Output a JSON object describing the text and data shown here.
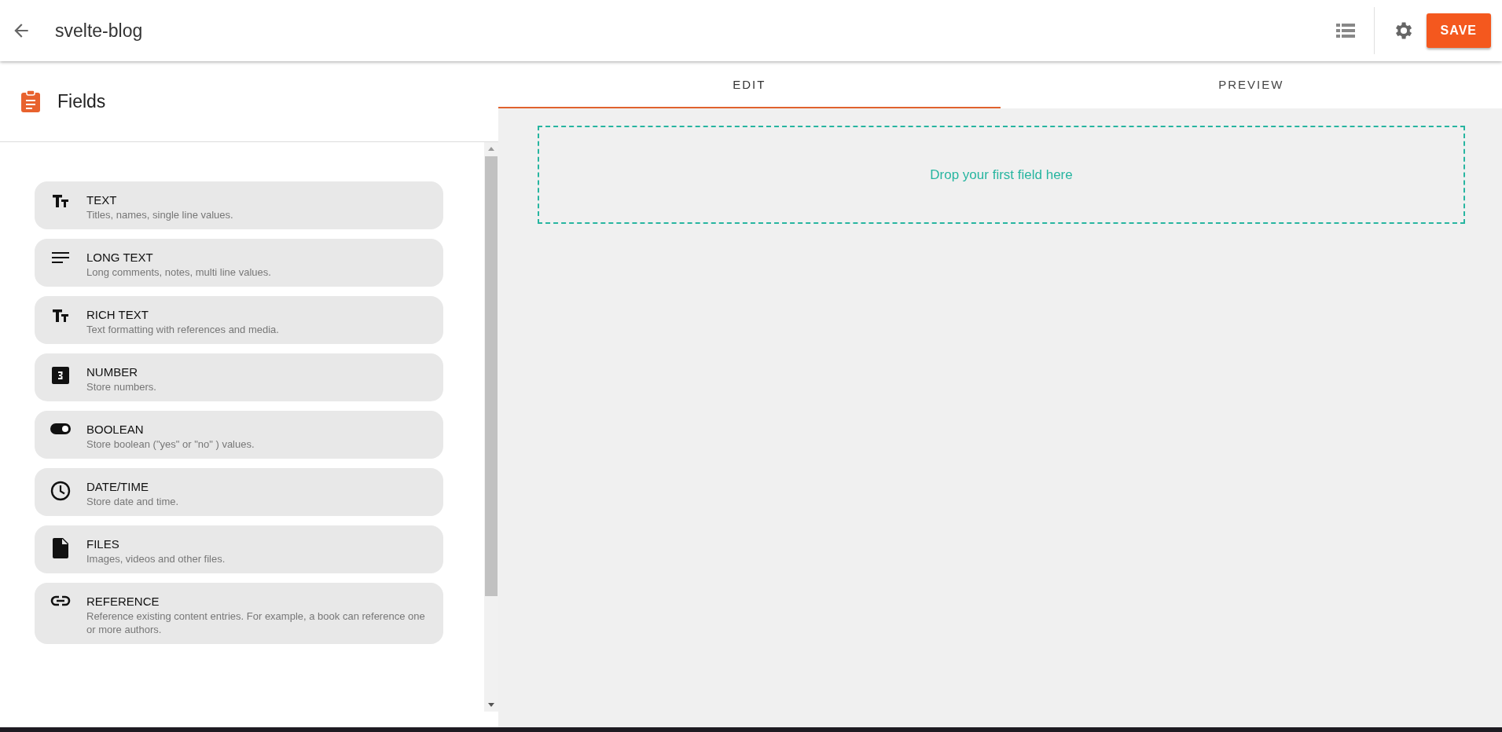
{
  "app_bar": {
    "title": "svelte-blog",
    "save_label": "SAVE"
  },
  "sidebar": {
    "title": "Fields",
    "items": [
      {
        "kind": "text",
        "label": "TEXT",
        "description": "Titles, names, single line values."
      },
      {
        "kind": "longtext",
        "label": "LONG TEXT",
        "description": "Long comments, notes, multi line values."
      },
      {
        "kind": "richtext",
        "label": "RICH TEXT",
        "description": "Text formatting with references and media."
      },
      {
        "kind": "number",
        "label": "NUMBER",
        "description": "Store numbers."
      },
      {
        "kind": "boolean",
        "label": "BOOLEAN",
        "description": "Store boolean (\"yes\" or \"no\" ) values."
      },
      {
        "kind": "datetime",
        "label": "DATE/TIME",
        "description": "Store date and time."
      },
      {
        "kind": "files",
        "label": "FILES",
        "description": "Images, videos and other files."
      },
      {
        "kind": "reference",
        "label": "REFERENCE",
        "description": "Reference existing content entries. For example, a book can reference one or more authors."
      }
    ]
  },
  "tabs": [
    {
      "label": "EDIT",
      "selected": true
    },
    {
      "label": "PREVIEW",
      "selected": false
    }
  ],
  "drop_zone": {
    "text": "Drop your first field here"
  }
}
